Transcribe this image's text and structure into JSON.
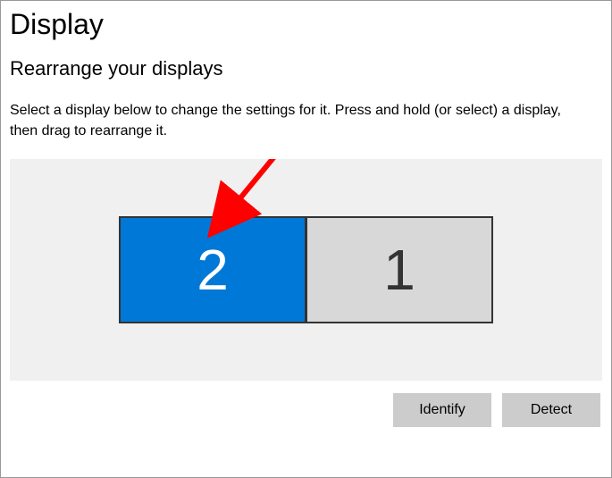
{
  "page": {
    "title": "Display",
    "section_title": "Rearrange your displays",
    "description": "Select a display below to change the settings for it. Press and hold (or select) a display, then drag to rearrange it."
  },
  "monitors": {
    "left": {
      "label": "2",
      "selected": true
    },
    "right": {
      "label": "1",
      "selected": false
    }
  },
  "buttons": {
    "identify": "Identify",
    "detect": "Detect"
  },
  "colors": {
    "accent": "#0078d7",
    "panel_bg": "#f0f0f0",
    "button_bg": "#cccccc",
    "monitor_unselected_bg": "#d8d8d8",
    "arrow": "#ff0000"
  }
}
